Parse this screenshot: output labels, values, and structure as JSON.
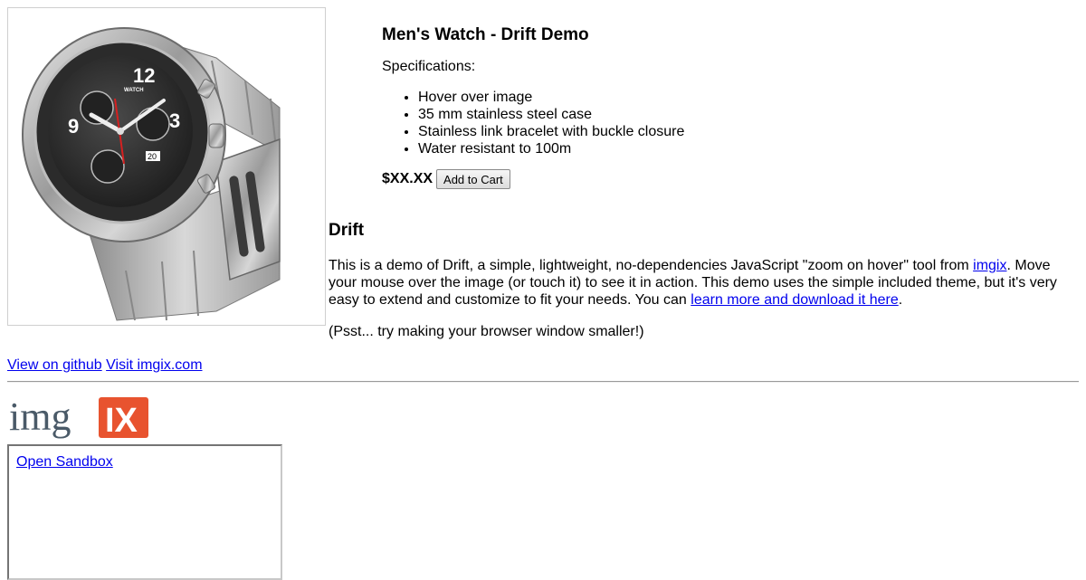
{
  "product": {
    "title": "Men's Watch - Drift Demo",
    "specs_heading": "Specifications:",
    "specs": [
      "Hover over image",
      "35 mm stainless steel case",
      "Stainless link bracelet with buckle closure",
      "Water resistant to 100m"
    ],
    "price": "$XX.XX",
    "add_to_cart_label": "Add to Cart",
    "image_alt": "Men's chronograph watch with stainless link bracelet"
  },
  "drift": {
    "heading": "Drift",
    "desc_before_link": "This is a demo of Drift, a simple, lightweight, no-dependencies JavaScript \"zoom on hover\" tool from ",
    "imgix_link": "imgix",
    "desc_middle": ". Move your mouse over the image (or touch it) to see it in action. This demo uses the simple included theme, but it's very easy to extend and customize to fit your needs. You can ",
    "learn_more_link": "learn more and download it here",
    "desc_end": ".",
    "psst": "(Psst... try making your browser window smaller!)"
  },
  "footer": {
    "github_link": "View on github",
    "imgix_site_link": "Visit imgix.com",
    "logo_text_left": "img",
    "logo_text_right": "IX",
    "open_sandbox": "Open Sandbox"
  },
  "colors": {
    "link": "#0000ee",
    "logo_slate": "#4a5a68",
    "logo_orange": "#e8532f"
  },
  "watch_dial": {
    "brand": "WATCH",
    "numerals": [
      "12",
      "3",
      "9"
    ],
    "date": "20"
  }
}
